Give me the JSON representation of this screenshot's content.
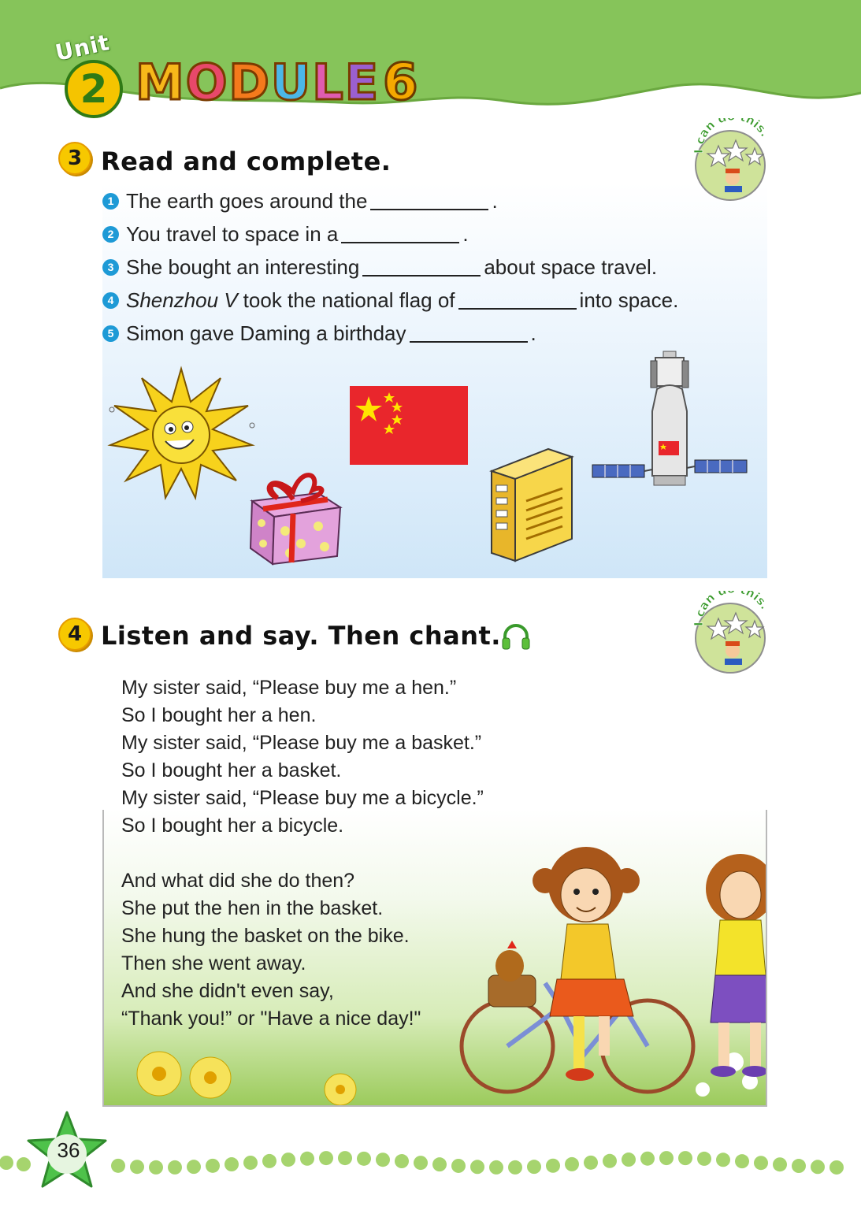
{
  "header": {
    "unit_word": "Unit",
    "unit_number": "2",
    "module_word": "MODULE",
    "module_number": "6"
  },
  "badge": {
    "text": "I can do this."
  },
  "exercise3": {
    "number": "3",
    "title": "Read and complete.",
    "items": [
      {
        "num": "1",
        "before": "The earth goes around the",
        "after": ".",
        "italic": ""
      },
      {
        "num": "2",
        "before": "You travel to space in a",
        "after": ".",
        "italic": ""
      },
      {
        "num": "3",
        "before": "She bought an interesting",
        "after": "about space travel.",
        "italic": ""
      },
      {
        "num": "4",
        "before": "took the national flag of",
        "after": "into space.",
        "italic": "Shenzhou V"
      },
      {
        "num": "5",
        "before": "Simon gave Daming a birthday",
        "after": ".",
        "italic": ""
      }
    ],
    "pictures": [
      "sun",
      "gift-box",
      "china-flag",
      "book",
      "spaceship"
    ]
  },
  "exercise4": {
    "number": "4",
    "title": "Listen and say. Then chant.",
    "icon": "headphones-icon",
    "lines": [
      "My sister said, “Please buy me a hen.”",
      "So I bought her a hen.",
      "My sister said, “Please buy me a basket.”",
      "So I bought her a basket.",
      "My sister said, “Please buy me a bicycle.”",
      "So I bought her a bicycle.",
      "And what did she do then?",
      "She put the hen in the basket.",
      "She hung the basket on the bike.",
      "Then she went away.",
      "And she didn't even say,",
      "“Thank you!” or \"Have a nice day!\""
    ]
  },
  "footer": {
    "page_number": "36"
  },
  "colors": {
    "header_green": "#86c45a",
    "badge_yellow": "#f7c800",
    "question_blue": "#1e9ad6",
    "dot_green": "#a6d46e"
  }
}
